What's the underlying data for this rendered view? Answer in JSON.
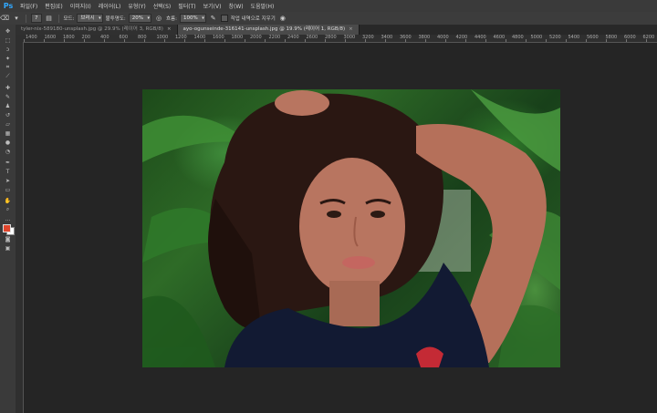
{
  "app": {
    "logo": "Ps"
  },
  "menu": [
    "파일(F)",
    "편집(E)",
    "이미지(I)",
    "레이어(L)",
    "유형(Y)",
    "선택(S)",
    "필터(T)",
    "보기(V)",
    "창(W)",
    "도움말(H)"
  ],
  "options": {
    "brush_size": "7",
    "mode_label": "모드:",
    "mode_value": "브러시",
    "opacity_label": "불투명도:",
    "opacity_value": "20%",
    "flow_label": "흐름:",
    "flow_value": "100%",
    "history_label": "작업 내역으로 지우기"
  },
  "tabs": [
    {
      "label": "tyler-nix-589180-unsplash.jpg @ 29.9% (레이어 3, RGB/8)",
      "active": false
    },
    {
      "label": "ayo-ogunseinde-316141-unsplash.jpg @ 19.9% (레이어 1, RGB/8)",
      "active": true
    }
  ],
  "ruler_ticks": [
    "1400",
    "1600",
    "1800",
    "200",
    "400",
    "600",
    "800",
    "1000",
    "1200",
    "1400",
    "1600",
    "1800",
    "2000",
    "2200",
    "2400",
    "2600",
    "2800",
    "3000",
    "3200",
    "3400",
    "3600",
    "3800",
    "4000",
    "4200",
    "4400",
    "4600",
    "4800",
    "5000",
    "5200",
    "5400",
    "5600",
    "5800",
    "6000",
    "6200"
  ],
  "tools": [
    "move-icon",
    "marquee-icon",
    "lasso-icon",
    "magic-wand-icon",
    "crop-icon",
    "eyedropper-icon",
    "healing-icon",
    "brush-icon",
    "stamp-icon",
    "history-brush-icon",
    "eraser-icon",
    "gradient-icon",
    "blur-icon",
    "dodge-icon",
    "pen-icon",
    "type-icon",
    "path-select-icon",
    "shape-icon",
    "hand-icon",
    "zoom-icon"
  ],
  "colors": {
    "foreground": "#e0452c",
    "background": "#ffffff",
    "accent": "#31a8ff"
  }
}
